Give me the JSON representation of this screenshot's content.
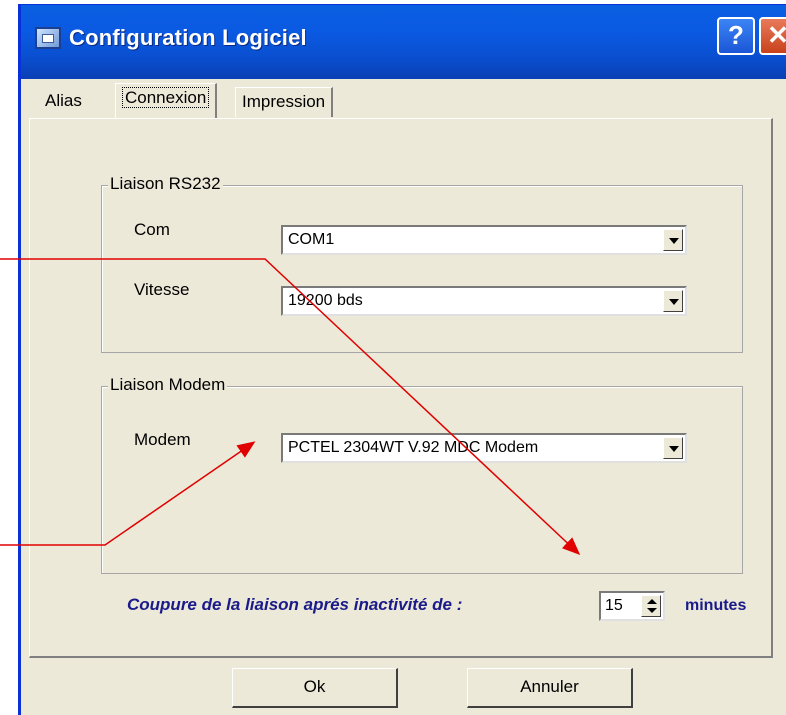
{
  "window": {
    "title": "Configuration Logiciel"
  },
  "titlebar": {
    "help_label": "?",
    "close_label": "✕"
  },
  "tabs": [
    {
      "label": "Alias",
      "active": false
    },
    {
      "label": "Connexion",
      "active": true
    },
    {
      "label": "Impression",
      "active": false
    }
  ],
  "rs232": {
    "legend": "Liaison RS232",
    "com_label": "Com",
    "com_value": "COM1",
    "speed_label": "Vitesse",
    "speed_value": "19200 bds"
  },
  "modem": {
    "legend": "Liaison Modem",
    "modem_label": "Modem",
    "modem_value": "PCTEL 2304WT V.92 MDC Modem"
  },
  "timeout": {
    "label": "Coupure de la liaison aprés inactivité de :",
    "value": "15",
    "unit": "minutes"
  },
  "buttons": {
    "ok": "Ok",
    "cancel": "Annuler"
  },
  "colors": {
    "titlebar": "#0a5fe0",
    "dialog_bg": "#ece9d8",
    "annotation_arrow": "#e00000",
    "timeout_text": "#1a1a8a"
  }
}
